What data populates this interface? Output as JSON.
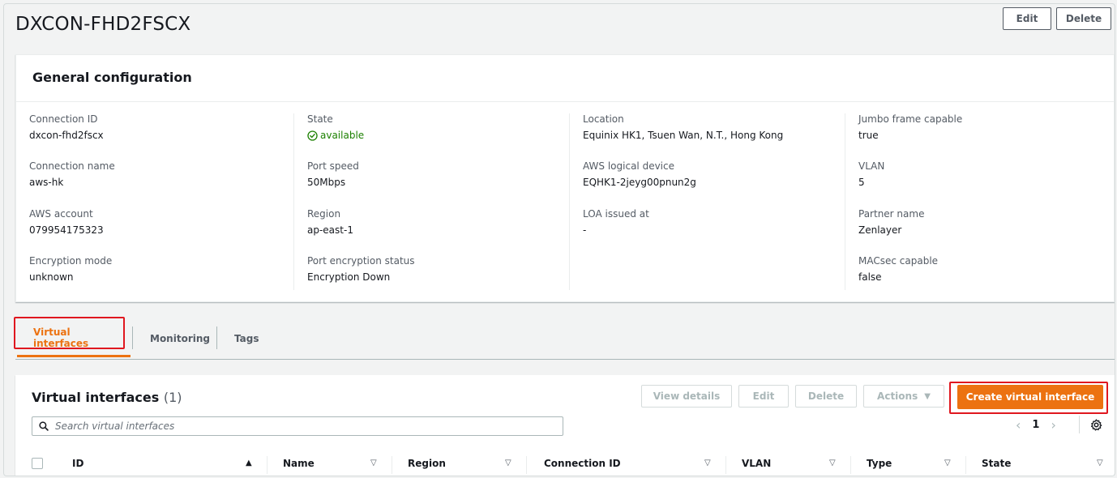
{
  "header": {
    "title": "DXCON-FHD2FSCX",
    "edit_label": "Edit",
    "delete_label": "Delete"
  },
  "general": {
    "title": "General configuration",
    "columns": [
      [
        {
          "label": "Connection ID",
          "value": "dxcon-fhd2fscx"
        },
        {
          "label": "Connection name",
          "value": "aws-hk"
        },
        {
          "label": "AWS account",
          "value": "079954175323"
        },
        {
          "label": "Encryption mode",
          "value": "unknown"
        }
      ],
      [
        {
          "label": "State",
          "value": "available"
        },
        {
          "label": "Port speed",
          "value": "50Mbps"
        },
        {
          "label": "Region",
          "value": "ap-east-1"
        },
        {
          "label": "Port encryption status",
          "value": "Encryption Down"
        }
      ],
      [
        {
          "label": "Location",
          "value": "Equinix HK1, Tsuen Wan, N.T., Hong Kong"
        },
        {
          "label": "AWS logical device",
          "value": "EQHK1-2jeyg00pnun2g"
        },
        {
          "label": "LOA issued at",
          "value": "-"
        }
      ],
      [
        {
          "label": "Jumbo frame capable",
          "value": "true"
        },
        {
          "label": "VLAN",
          "value": "5"
        },
        {
          "label": "Partner name",
          "value": "Zenlayer"
        },
        {
          "label": "MACsec capable",
          "value": "false"
        }
      ]
    ]
  },
  "tabs": [
    {
      "label": "Virtual interfaces",
      "active": true
    },
    {
      "label": "Monitoring",
      "active": false
    },
    {
      "label": "Tags",
      "active": false
    }
  ],
  "vif": {
    "title": "Virtual interfaces",
    "count": "(1)",
    "buttons": {
      "view_details": "View details",
      "edit": "Edit",
      "delete": "Delete",
      "actions": "Actions",
      "create": "Create virtual interface"
    },
    "search_placeholder": "Search virtual interfaces",
    "page": "1",
    "columns": [
      "ID",
      "Name",
      "Region",
      "Connection ID",
      "VLAN",
      "Type",
      "State"
    ]
  },
  "colors": {
    "accent": "#ec7211",
    "success": "#1d8102",
    "highlight_box": "#e0171f"
  }
}
